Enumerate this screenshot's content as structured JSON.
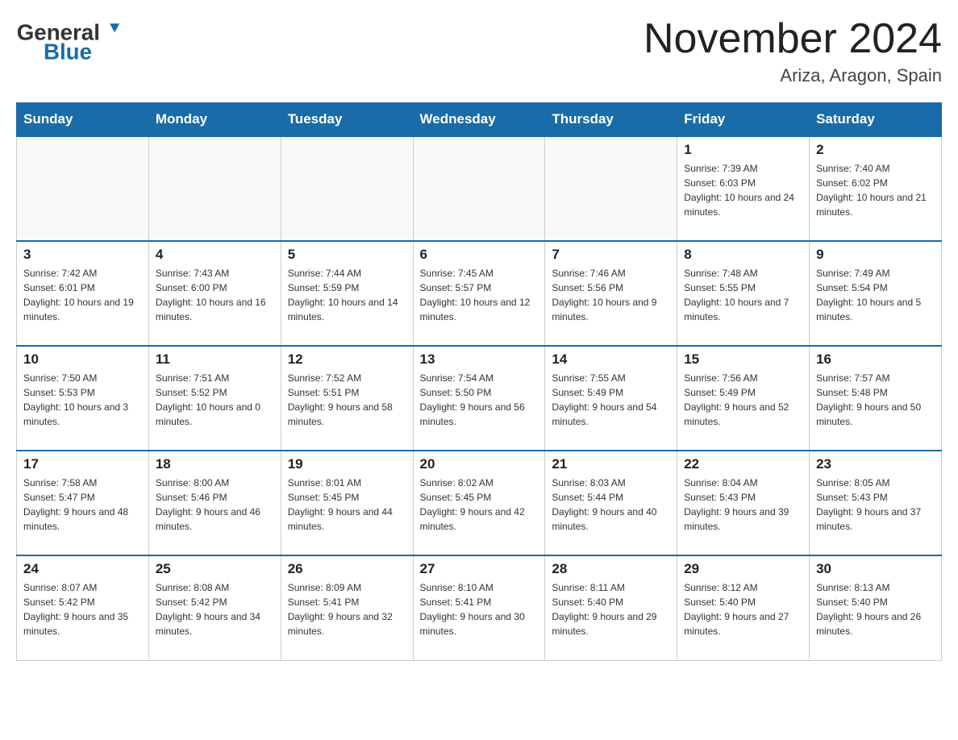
{
  "header": {
    "logo_general": "General",
    "logo_blue": "Blue",
    "month_title": "November 2024",
    "location": "Ariza, Aragon, Spain"
  },
  "days_of_week": [
    "Sunday",
    "Monday",
    "Tuesday",
    "Wednesday",
    "Thursday",
    "Friday",
    "Saturday"
  ],
  "weeks": [
    [
      {
        "day": "",
        "info": ""
      },
      {
        "day": "",
        "info": ""
      },
      {
        "day": "",
        "info": ""
      },
      {
        "day": "",
        "info": ""
      },
      {
        "day": "",
        "info": ""
      },
      {
        "day": "1",
        "info": "Sunrise: 7:39 AM\nSunset: 6:03 PM\nDaylight: 10 hours and 24 minutes."
      },
      {
        "day": "2",
        "info": "Sunrise: 7:40 AM\nSunset: 6:02 PM\nDaylight: 10 hours and 21 minutes."
      }
    ],
    [
      {
        "day": "3",
        "info": "Sunrise: 7:42 AM\nSunset: 6:01 PM\nDaylight: 10 hours and 19 minutes."
      },
      {
        "day": "4",
        "info": "Sunrise: 7:43 AM\nSunset: 6:00 PM\nDaylight: 10 hours and 16 minutes."
      },
      {
        "day": "5",
        "info": "Sunrise: 7:44 AM\nSunset: 5:59 PM\nDaylight: 10 hours and 14 minutes."
      },
      {
        "day": "6",
        "info": "Sunrise: 7:45 AM\nSunset: 5:57 PM\nDaylight: 10 hours and 12 minutes."
      },
      {
        "day": "7",
        "info": "Sunrise: 7:46 AM\nSunset: 5:56 PM\nDaylight: 10 hours and 9 minutes."
      },
      {
        "day": "8",
        "info": "Sunrise: 7:48 AM\nSunset: 5:55 PM\nDaylight: 10 hours and 7 minutes."
      },
      {
        "day": "9",
        "info": "Sunrise: 7:49 AM\nSunset: 5:54 PM\nDaylight: 10 hours and 5 minutes."
      }
    ],
    [
      {
        "day": "10",
        "info": "Sunrise: 7:50 AM\nSunset: 5:53 PM\nDaylight: 10 hours and 3 minutes."
      },
      {
        "day": "11",
        "info": "Sunrise: 7:51 AM\nSunset: 5:52 PM\nDaylight: 10 hours and 0 minutes."
      },
      {
        "day": "12",
        "info": "Sunrise: 7:52 AM\nSunset: 5:51 PM\nDaylight: 9 hours and 58 minutes."
      },
      {
        "day": "13",
        "info": "Sunrise: 7:54 AM\nSunset: 5:50 PM\nDaylight: 9 hours and 56 minutes."
      },
      {
        "day": "14",
        "info": "Sunrise: 7:55 AM\nSunset: 5:49 PM\nDaylight: 9 hours and 54 minutes."
      },
      {
        "day": "15",
        "info": "Sunrise: 7:56 AM\nSunset: 5:49 PM\nDaylight: 9 hours and 52 minutes."
      },
      {
        "day": "16",
        "info": "Sunrise: 7:57 AM\nSunset: 5:48 PM\nDaylight: 9 hours and 50 minutes."
      }
    ],
    [
      {
        "day": "17",
        "info": "Sunrise: 7:58 AM\nSunset: 5:47 PM\nDaylight: 9 hours and 48 minutes."
      },
      {
        "day": "18",
        "info": "Sunrise: 8:00 AM\nSunset: 5:46 PM\nDaylight: 9 hours and 46 minutes."
      },
      {
        "day": "19",
        "info": "Sunrise: 8:01 AM\nSunset: 5:45 PM\nDaylight: 9 hours and 44 minutes."
      },
      {
        "day": "20",
        "info": "Sunrise: 8:02 AM\nSunset: 5:45 PM\nDaylight: 9 hours and 42 minutes."
      },
      {
        "day": "21",
        "info": "Sunrise: 8:03 AM\nSunset: 5:44 PM\nDaylight: 9 hours and 40 minutes."
      },
      {
        "day": "22",
        "info": "Sunrise: 8:04 AM\nSunset: 5:43 PM\nDaylight: 9 hours and 39 minutes."
      },
      {
        "day": "23",
        "info": "Sunrise: 8:05 AM\nSunset: 5:43 PM\nDaylight: 9 hours and 37 minutes."
      }
    ],
    [
      {
        "day": "24",
        "info": "Sunrise: 8:07 AM\nSunset: 5:42 PM\nDaylight: 9 hours and 35 minutes."
      },
      {
        "day": "25",
        "info": "Sunrise: 8:08 AM\nSunset: 5:42 PM\nDaylight: 9 hours and 34 minutes."
      },
      {
        "day": "26",
        "info": "Sunrise: 8:09 AM\nSunset: 5:41 PM\nDaylight: 9 hours and 32 minutes."
      },
      {
        "day": "27",
        "info": "Sunrise: 8:10 AM\nSunset: 5:41 PM\nDaylight: 9 hours and 30 minutes."
      },
      {
        "day": "28",
        "info": "Sunrise: 8:11 AM\nSunset: 5:40 PM\nDaylight: 9 hours and 29 minutes."
      },
      {
        "day": "29",
        "info": "Sunrise: 8:12 AM\nSunset: 5:40 PM\nDaylight: 9 hours and 27 minutes."
      },
      {
        "day": "30",
        "info": "Sunrise: 8:13 AM\nSunset: 5:40 PM\nDaylight: 9 hours and 26 minutes."
      }
    ]
  ]
}
